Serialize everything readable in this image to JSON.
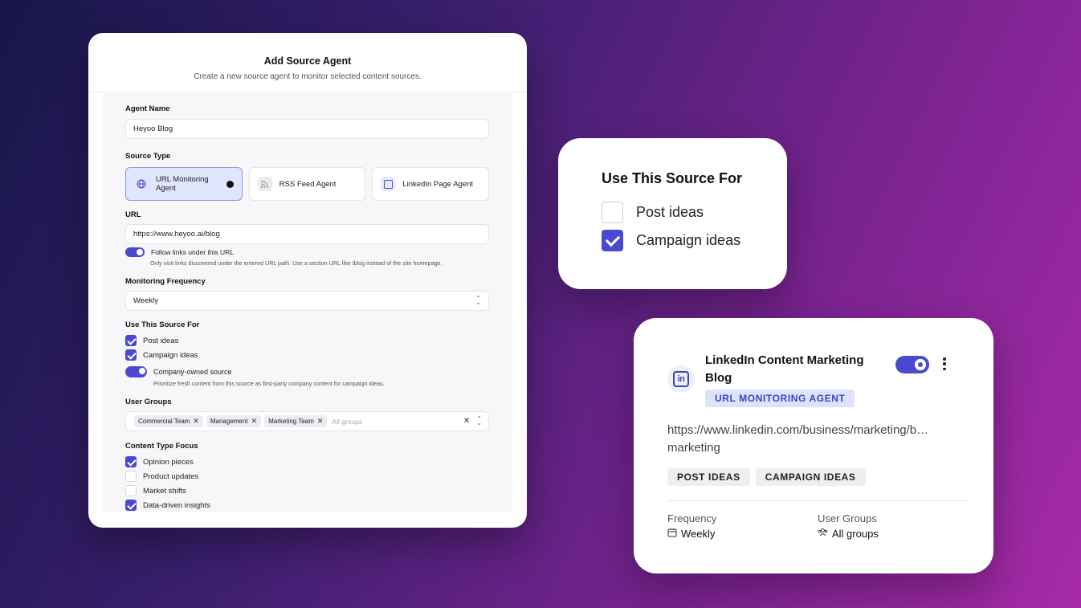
{
  "modal": {
    "title": "Add Source Agent",
    "subtitle": "Create a new source agent to monitor selected content sources.",
    "agent_name_label": "Agent Name",
    "agent_name_value": "Heyoo Blog",
    "source_type_label": "Source Type",
    "source_types": [
      {
        "label": "URL Monitoring Agent",
        "icon": "globe-icon",
        "selected": true
      },
      {
        "label": "RSS Feed Agent",
        "icon": "rss-icon",
        "selected": false
      },
      {
        "label": "LinkedIn Page Agent",
        "icon": "linkedin-icon",
        "selected": false
      }
    ],
    "url_label": "URL",
    "url_value": "https://www.heyoo.ai/blog",
    "follow_links_label": "Follow links under this URL",
    "follow_links_hint": "Only visit links discovered under the entered URL path. Use a section URL like /blog instead of the site homepage.",
    "frequency_label": "Monitoring Frequency",
    "frequency_value": "Weekly",
    "use_for_label": "Use This Source For",
    "use_for": [
      {
        "label": "Post ideas",
        "checked": true
      },
      {
        "label": "Campaign ideas",
        "checked": true
      }
    ],
    "company_owned_label": "Company-owned source",
    "company_owned_hint": "Prioritize fresh content from this source as first-party company content for campaign ideas.",
    "user_groups_label": "User Groups",
    "user_groups": [
      "Commercial Team",
      "Management",
      "Marketing Team"
    ],
    "user_groups_placeholder": "All groups",
    "content_focus_label": "Content Type Focus",
    "content_focus": [
      {
        "label": "Opinion pieces",
        "checked": true
      },
      {
        "label": "Product updates",
        "checked": false
      },
      {
        "label": "Market shifts",
        "checked": false
      },
      {
        "label": "Data-driven insights",
        "checked": true
      }
    ]
  },
  "use_card": {
    "title": "Use This Source For",
    "options": [
      {
        "label": "Post ideas",
        "checked": false
      },
      {
        "label": "Campaign ideas",
        "checked": true
      }
    ]
  },
  "li_card": {
    "title": "LinkedIn Content Marketing Blog",
    "badge": "URL MONITORING AGENT",
    "url_line1": "https://www.linkedin.com/business/marketing/b…",
    "url_line2": "marketing",
    "tags": [
      "POST IDEAS",
      "CAMPAIGN IDEAS"
    ],
    "frequency_label": "Frequency",
    "frequency_value": "Weekly",
    "groups_label": "User Groups",
    "groups_value": "All groups"
  },
  "colors": {
    "accent": "#4a4ad0",
    "badge_bg": "#dde3fa",
    "badge_text": "#3a45c0"
  }
}
